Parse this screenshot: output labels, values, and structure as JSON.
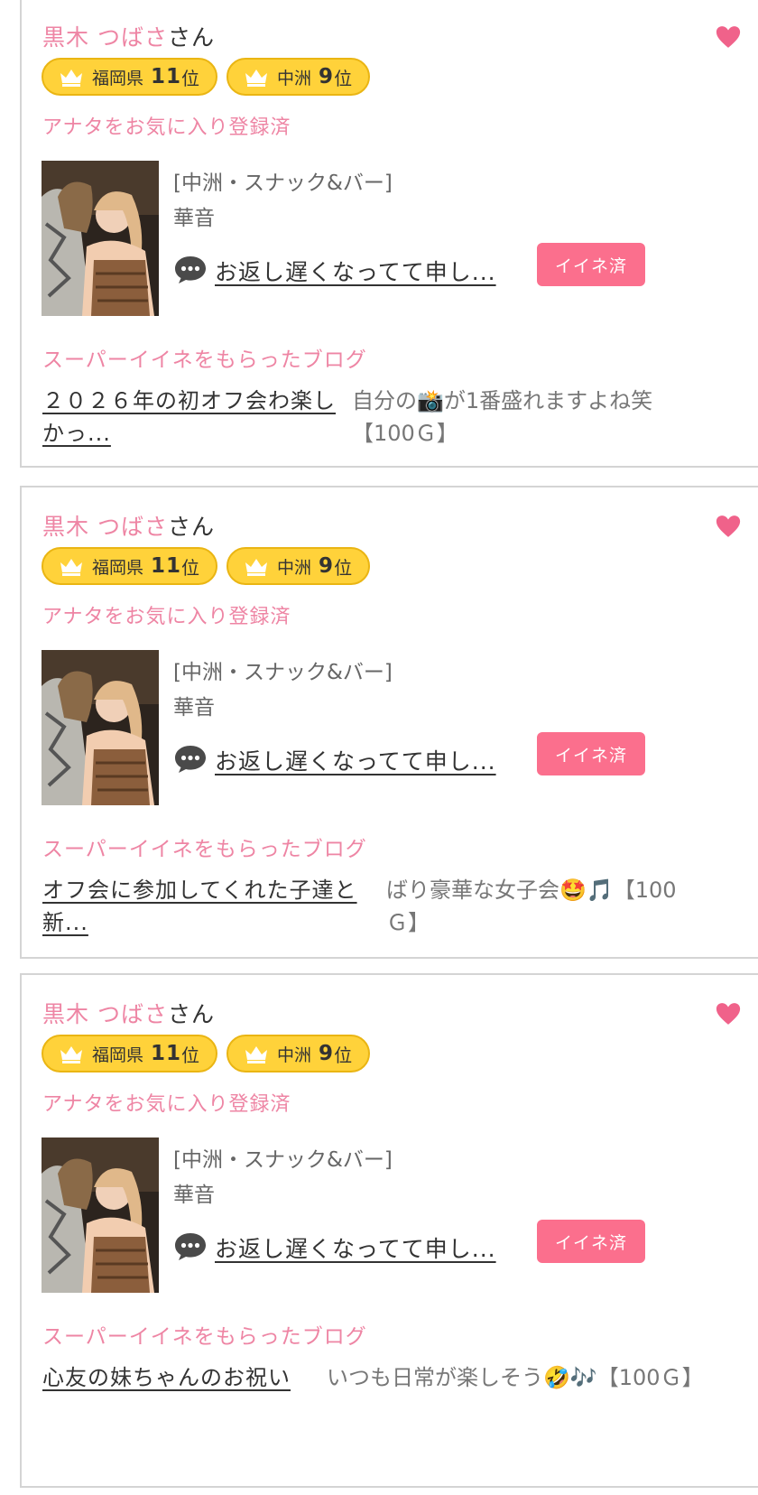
{
  "cards": [
    {
      "user_name": "黒木 つばさ",
      "user_suffix": "さん",
      "badges": [
        {
          "area": "福岡県",
          "rank": "11",
          "unit": "位"
        },
        {
          "area": "中洲",
          "rank": "9",
          "unit": "位"
        }
      ],
      "favorite_status": "アナタをお気に入り登録済",
      "shop_category": "[中洲・スナック&バー]",
      "shop_person": "華音",
      "message": "お返し遅くなってて申し...",
      "like_button": "イイネ済",
      "section_label": "スーパーイイネをもらったブログ",
      "blog_title": "２０２６年の初オフ会わ楽しかっ...",
      "blog_comment": "自分の📸が1番盛れますよね笑【100Ｇ】"
    },
    {
      "user_name": "黒木 つばさ",
      "user_suffix": "さん",
      "badges": [
        {
          "area": "福岡県",
          "rank": "11",
          "unit": "位"
        },
        {
          "area": "中洲",
          "rank": "9",
          "unit": "位"
        }
      ],
      "favorite_status": "アナタをお気に入り登録済",
      "shop_category": "[中洲・スナック&バー]",
      "shop_person": "華音",
      "message": "お返し遅くなってて申し...",
      "like_button": "イイネ済",
      "section_label": "スーパーイイネをもらったブログ",
      "blog_title": "オフ会に参加してくれた子達と新...",
      "blog_comment": "ばり豪華な女子会🤩🎵【100Ｇ】"
    },
    {
      "user_name": "黒木 つばさ",
      "user_suffix": "さん",
      "badges": [
        {
          "area": "福岡県",
          "rank": "11",
          "unit": "位"
        },
        {
          "area": "中洲",
          "rank": "9",
          "unit": "位"
        }
      ],
      "favorite_status": "アナタをお気に入り登録済",
      "shop_category": "[中洲・スナック&バー]",
      "shop_person": "華音",
      "message": "お返し遅くなってて申し...",
      "like_button": "イイネ済",
      "section_label": "スーパーイイネをもらったブログ",
      "blog_title": "心友の妹ちゃんのお祝い",
      "blog_comment": "いつも日常が楽しそう🤣🎶【100Ｇ】"
    }
  ],
  "icons": {
    "heart": "heart-icon",
    "crown": "crown-icon",
    "comment": "comment-bubble-icon"
  },
  "colors": {
    "accent_pink": "#ee85a4",
    "button_pink": "#fb6f8d",
    "badge_yellow": "#ffd23a"
  }
}
